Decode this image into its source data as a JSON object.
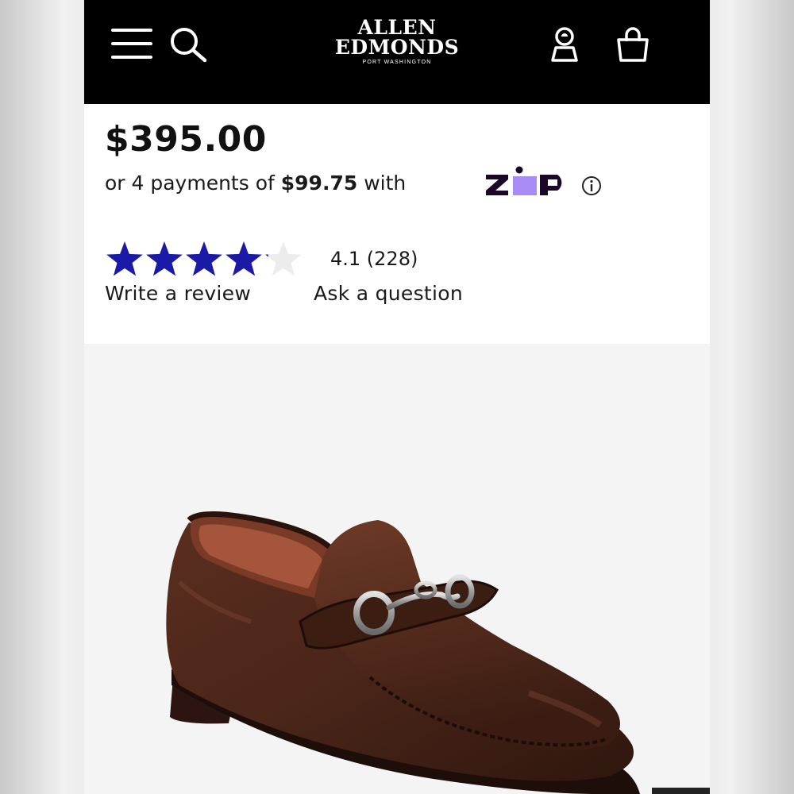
{
  "header": {
    "brand_line1": "ALLEN",
    "brand_line2": "EDMONDS",
    "brand_sub": "PORT WASHINGTON",
    "menu_icon": "hamburger-menu-icon",
    "search_icon": "search-icon",
    "account_icon": "account-icon",
    "bag_icon": "shopping-bag-icon"
  },
  "product": {
    "price": "$395.00",
    "payments_prefix": "or 4 payments of ",
    "payment_amount": "$99.75",
    "payments_suffix": " with",
    "payment_provider": "zip",
    "rating_text": "4.1 (228)",
    "rating_value": 4.1,
    "rating_max": 5,
    "write_review": "Write a review",
    "ask_question": "Ask a question"
  },
  "colors": {
    "header_bg": "#000000",
    "star_fill": "#1a1aa6",
    "star_empty": "#ececec",
    "zip_purple": "#a98bf5",
    "zip_dark": "#1a0826",
    "shoe_leather": "#4a2519"
  }
}
